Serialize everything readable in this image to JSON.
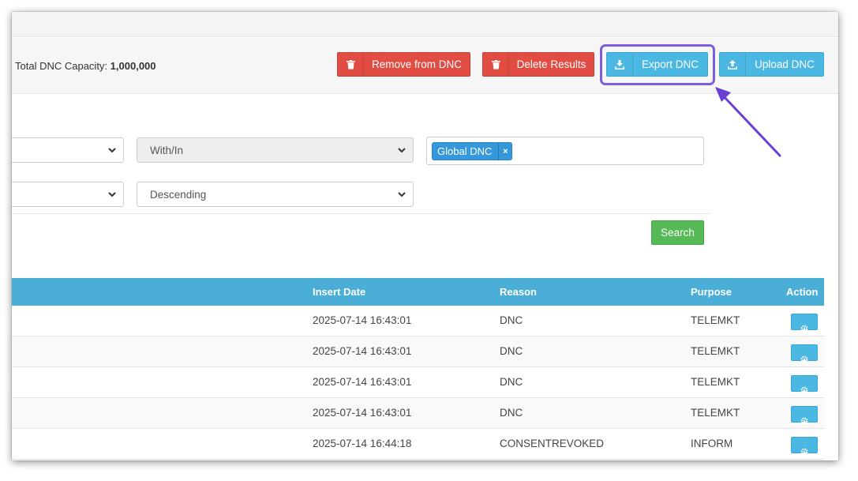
{
  "toolbar": {
    "capacity_label": "Total DNC Capacity:",
    "capacity_value": "1,000,000",
    "remove_label": "Remove from DNC",
    "delete_label": "Delete Results",
    "export_label": "Export DNC",
    "upload_label": "Upload DNC"
  },
  "filters": {
    "match_value": "With/In",
    "order_value": "Descending",
    "list_tag": "Global DNC",
    "tag_remove": "×",
    "search_label": "Search"
  },
  "table": {
    "headers": {
      "insert_date": "Insert Date",
      "reason": "Reason",
      "purpose": "Purpose",
      "action": "Action"
    },
    "rows": [
      {
        "insert_date": "2025-07-14 16:43:01",
        "reason": "DNC",
        "purpose": "TELEMKT"
      },
      {
        "insert_date": "2025-07-14 16:43:01",
        "reason": "DNC",
        "purpose": "TELEMKT"
      },
      {
        "insert_date": "2025-07-14 16:43:01",
        "reason": "DNC",
        "purpose": "TELEMKT"
      },
      {
        "insert_date": "2025-07-14 16:43:01",
        "reason": "DNC",
        "purpose": "TELEMKT"
      },
      {
        "insert_date": "2025-07-14 16:44:18",
        "reason": "CONSENTREVOKED",
        "purpose": "INFORM"
      }
    ]
  },
  "colors": {
    "danger": "#e14d43",
    "info": "#4ab8e3",
    "success": "#55b955",
    "header": "#4aaed6",
    "annotation": "#7c5ce0"
  },
  "icons": {
    "remove": "trash-icon",
    "delete": "trash-icon",
    "export": "download-icon",
    "upload": "upload-icon",
    "action": "gear-icon"
  }
}
